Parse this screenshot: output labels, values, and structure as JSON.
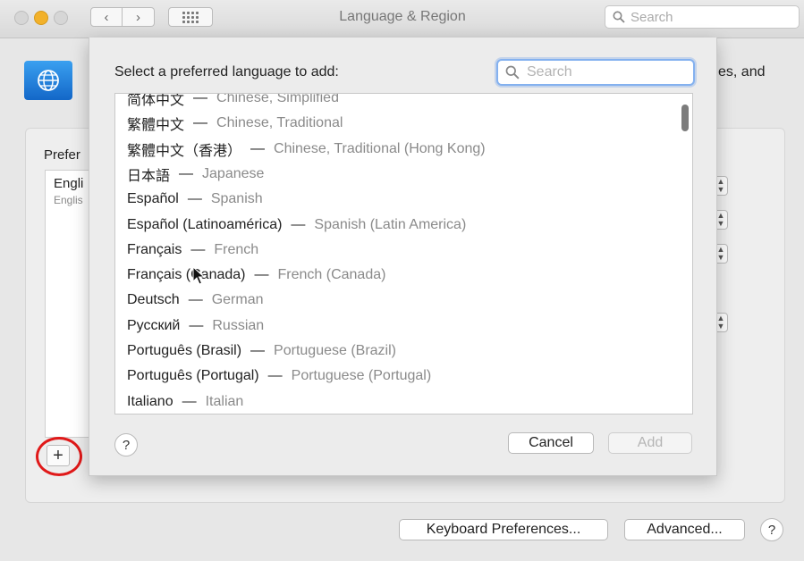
{
  "window": {
    "title": "Language & Region",
    "search_placeholder": "Search",
    "back_glyph": "‹",
    "forward_glyph": "›"
  },
  "background": {
    "partial_header_text": "es, and",
    "preferred_label_partial": "Prefer",
    "list_item_partial": "Engli",
    "list_item_sub_partial": "Englis",
    "plus_label": "+",
    "keyboard_button": "Keyboard Preferences...",
    "advanced_button": "Advanced...",
    "help_label": "?"
  },
  "sheet": {
    "title": "Select a preferred language to add:",
    "search_placeholder": "Search",
    "languages": [
      {
        "native": "简体中文",
        "english": "Chinese, Simplified"
      },
      {
        "native": "繁體中文",
        "english": "Chinese, Traditional"
      },
      {
        "native": "繁體中文（香港）",
        "english": "Chinese, Traditional (Hong Kong)"
      },
      {
        "native": "日本語",
        "english": "Japanese"
      },
      {
        "native": "Español",
        "english": "Spanish"
      },
      {
        "native": "Español (Latinoamérica)",
        "english": "Spanish (Latin America)"
      },
      {
        "native": "Français",
        "english": "French"
      },
      {
        "native": "Français (Canada)",
        "english": "French (Canada)"
      },
      {
        "native": "Deutsch",
        "english": "German"
      },
      {
        "native": "Русский",
        "english": "Russian"
      },
      {
        "native": "Português (Brasil)",
        "english": "Portuguese (Brazil)"
      },
      {
        "native": "Português (Portugal)",
        "english": "Portuguese (Portugal)"
      },
      {
        "native": "Italiano",
        "english": "Italian"
      }
    ],
    "dash": "—",
    "help_label": "?",
    "cancel_button": "Cancel",
    "add_button": "Add"
  },
  "colors": {
    "focus_ring": "#84b1ef",
    "highlight_circle": "#e01919",
    "minimize_light": "#f2b12a"
  },
  "icons": {
    "search": "magnifying-glass-icon",
    "globe": "globe-flag-icon",
    "grid": "show-all-grid-icon"
  }
}
